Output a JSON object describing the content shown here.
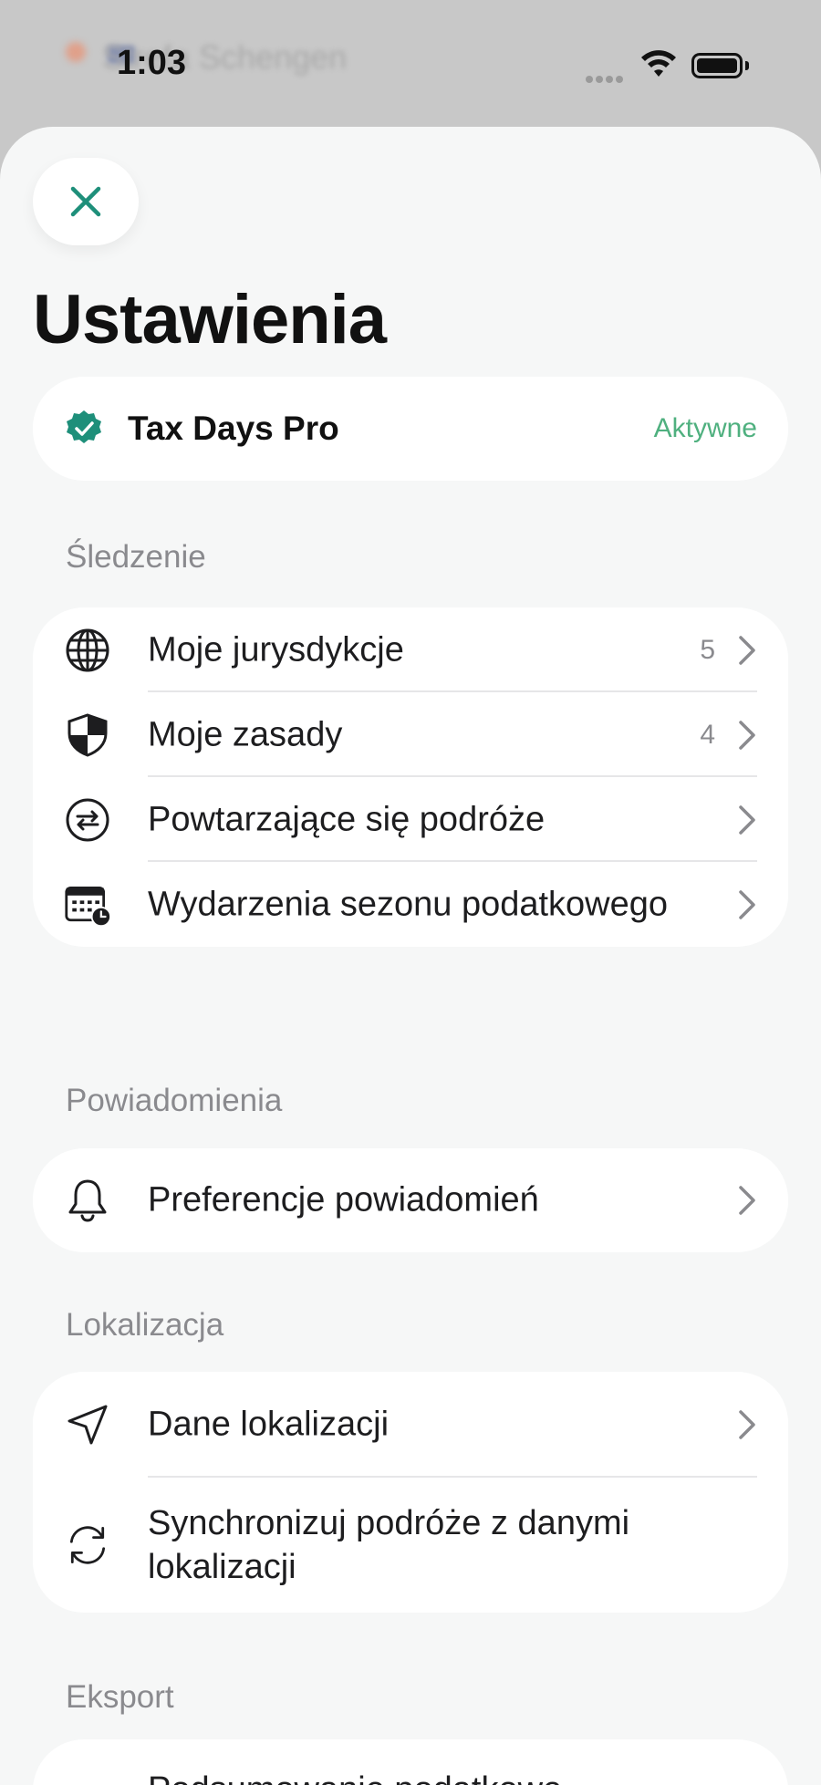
{
  "backdrop": {
    "text": "Strefa Schengen"
  },
  "status_bar": {
    "time": "1:03"
  },
  "title": "Ustawienia",
  "pro": {
    "label": "Tax Days Pro",
    "status": "Aktywne",
    "accent": "#1e8f7a"
  },
  "sections": {
    "tracking": {
      "header": "Śledzenie",
      "items": [
        {
          "label": "Moje jurysdykcje",
          "count": "5",
          "icon": "globe-icon"
        },
        {
          "label": "Moje zasady",
          "count": "4",
          "icon": "shield-icon"
        },
        {
          "label": "Powtarzające się podróże",
          "icon": "repeat-icon"
        },
        {
          "label": "Wydarzenia sezonu podatkowego",
          "icon": "calendar-clock-icon"
        }
      ]
    },
    "notifications": {
      "header": "Powiadomienia",
      "items": [
        {
          "label": "Preferencje powiadomień",
          "icon": "bell-icon"
        }
      ]
    },
    "location": {
      "header": "Lokalizacja",
      "items": [
        {
          "label": "Dane lokalizacji",
          "icon": "location-arrow-icon"
        },
        {
          "label": "Synchronizuj podróże z danymi lokalizacji",
          "icon": "sync-icon"
        }
      ]
    },
    "export": {
      "header": "Eksport",
      "items": [
        {
          "label": "Podsumowanie podatkowe",
          "icon": "document-icon"
        }
      ]
    }
  },
  "colors": {
    "accent": "#1e8f7a",
    "active": "#4fb07f",
    "muted": "#8a8a8e"
  }
}
